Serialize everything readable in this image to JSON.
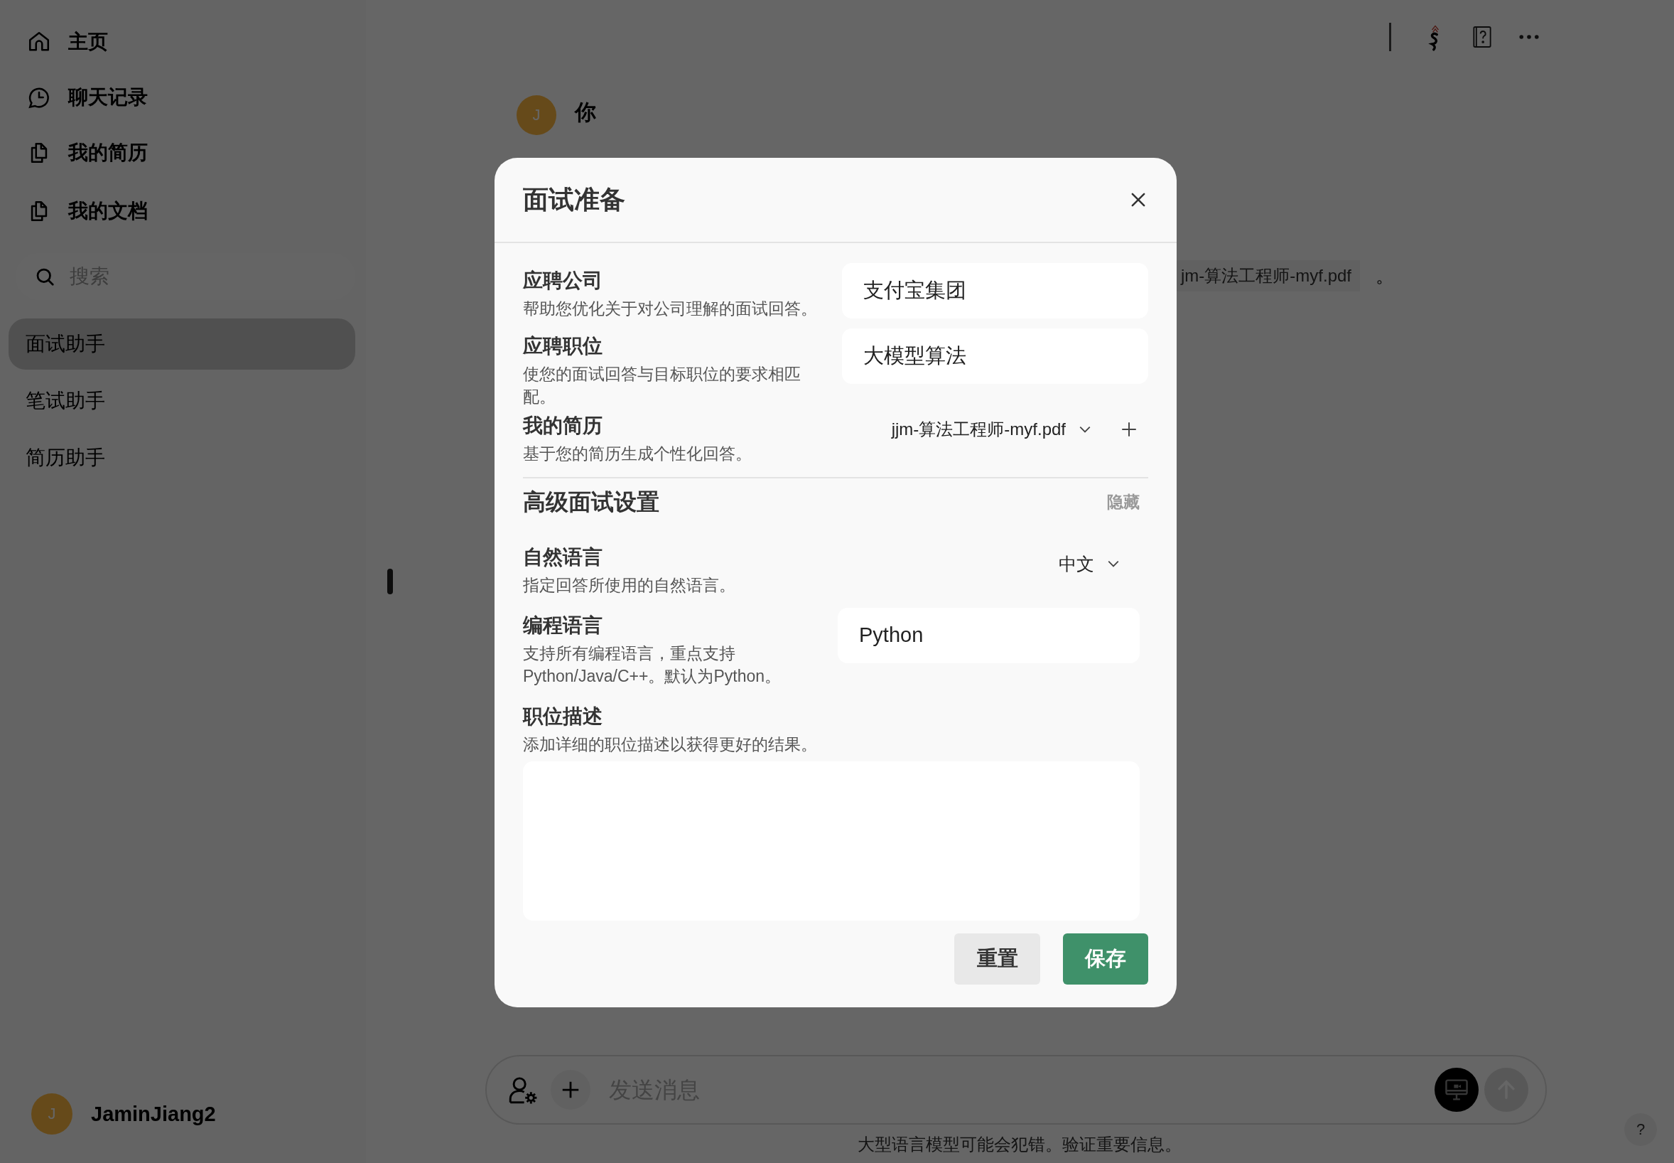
{
  "sidebar": {
    "nav": [
      {
        "kind": "home",
        "label": "主页"
      },
      {
        "kind": "history",
        "label": "聊天记录"
      },
      {
        "kind": "document",
        "label": "我的简历"
      },
      {
        "kind": "document",
        "label": "我的文档"
      }
    ],
    "search": {
      "placeholder": "搜索"
    },
    "assistants": [
      {
        "label": "面试助手",
        "selected": true
      },
      {
        "label": "笔试助手",
        "selected": false
      },
      {
        "label": "简历助手",
        "selected": false
      }
    ],
    "user": {
      "avatar_letter": "J",
      "name": "JaminJiang2"
    }
  },
  "chat": {
    "message": {
      "avatar_letter": "J",
      "author": "你"
    },
    "attachment": {
      "file": "jm-算法工程师-myf.pdf",
      "suffix": "。"
    },
    "input": {
      "placeholder": "发送消息"
    },
    "disclaimer": "大型语言模型可能会犯错。验证重要信息。",
    "help": "?"
  },
  "dialog": {
    "title": "面试准备",
    "fields": [
      {
        "kind": "text",
        "label": "应聘公司",
        "description": "帮助您优化关于对公司理解的面试回答。",
        "value": "支付宝集团"
      },
      {
        "kind": "text",
        "label": "应聘职位",
        "description": "使您的面试回答与目标职位的要求相匹配。",
        "value": "大模型算法"
      },
      {
        "kind": "file",
        "label": "我的简历",
        "description": "基于您的简历生成个性化回答。",
        "value": "jjm-算法工程师-myf.pdf"
      }
    ],
    "advanced": {
      "title": "高级面试设置",
      "toggle": "隐藏",
      "fields": [
        {
          "kind": "select",
          "label": "自然语言",
          "description": "指定回答所使用的自然语言。",
          "value": "中文"
        },
        {
          "kind": "text",
          "label": "编程语言",
          "description": "支持所有编程语言，重点支持Python/Java/C++。默认为Python。",
          "value": "Python"
        },
        {
          "kind": "textarea",
          "label": "职位描述",
          "description": "添加详细的职位描述以获得更好的结果。"
        }
      ]
    },
    "buttons": [
      {
        "kind": "secondary",
        "label": "重置"
      },
      {
        "kind": "primary",
        "label": "保存"
      }
    ]
  }
}
